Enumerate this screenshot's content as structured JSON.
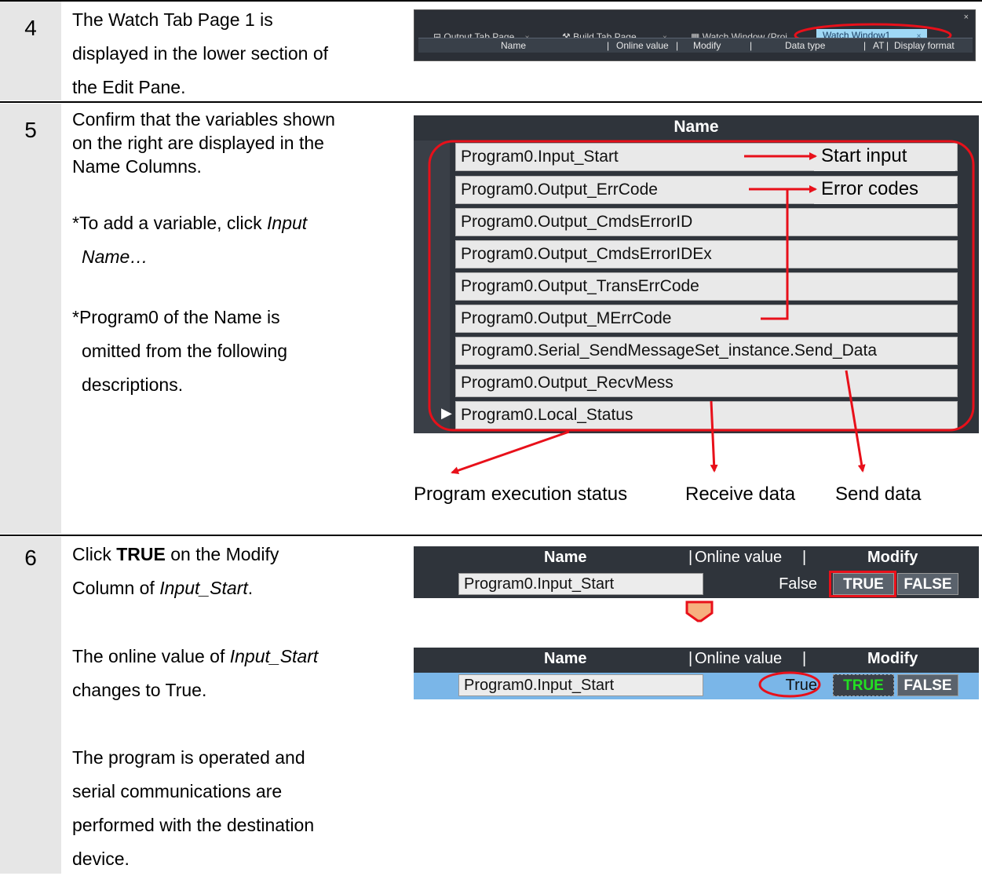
{
  "steps": [
    {
      "number": "4",
      "lines": [
        "The Watch Tab Page 1 is",
        "displayed in the lower section of",
        "the Edit Pane."
      ],
      "screenshot": {
        "close_glyph": "×",
        "tabs": [
          {
            "label": "Output Tab Page",
            "close": "×"
          },
          {
            "label": "Build Tab Page",
            "close": "×"
          },
          {
            "label": "Watch Window (Proj",
            "close": ""
          },
          {
            "label": "Watch Window1",
            "close": "×",
            "active": true
          }
        ],
        "columns": [
          "Name",
          "Online value",
          "Modify",
          "Data type",
          "AT",
          "Display format"
        ]
      }
    },
    {
      "number": "5",
      "lines": [
        "Confirm that the variables shown",
        "on the right are displayed in the",
        "Name Columns."
      ],
      "note1_prefix": "*To add a variable, click ",
      "note1_italic": "Input",
      "note1_italic2": "Name…",
      "note2_lines": [
        "*Program0 of the Name is",
        "omitted from the following",
        "descriptions."
      ],
      "panel": {
        "header": "Name",
        "variables": [
          "Program0.Input_Start",
          "Program0.Output_ErrCode",
          "Program0.Output_CmdsErrorID",
          "Program0.Output_CmdsErrorIDEx",
          "Program0.Output_TransErrCode",
          "Program0.Output_MErrCode",
          "Program0.Serial_SendMessageSet_instance.Send_Data",
          "Program0.Output_RecvMess",
          "Program0.Local_Status"
        ],
        "row_marker": "▶"
      },
      "callouts": {
        "start_input": "Start input",
        "error_codes": "Error codes",
        "program_status": "Program execution status",
        "receive_data": "Receive data",
        "send_data": "Send data"
      },
      "accent_color": "#e8101a"
    },
    {
      "number": "6",
      "line1_prefix": "Click ",
      "line1_bold": "TRUE",
      "line1_suffix": " on the Modify",
      "line2_prefix": "Column of ",
      "line2_italic": "Input_Start",
      "line2_suffix": ".",
      "line3_prefix": "The online value of ",
      "line3_italic": "Input_Start",
      "line4": "changes to True.",
      "para3": [
        "The program is operated and",
        "serial communications are",
        "performed with the destination",
        "device."
      ],
      "before": {
        "headers": [
          "Name",
          "Online value",
          "Modify"
        ],
        "sep": "|",
        "name": "Program0.Input_Start",
        "online_value": "False",
        "btn_true": "TRUE",
        "btn_false": "FALSE"
      },
      "after": {
        "headers": [
          "Name",
          "Online value",
          "Modify"
        ],
        "sep": "|",
        "name": "Program0.Input_Start",
        "online_value": "True",
        "btn_true": "TRUE",
        "btn_false": "FALSE"
      }
    }
  ]
}
